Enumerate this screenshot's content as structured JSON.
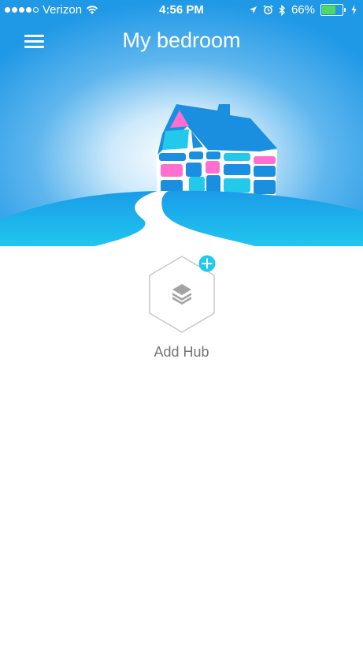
{
  "status_bar": {
    "carrier": "Verizon",
    "signal_bars_filled": 4,
    "signal_bars_total": 5,
    "time": "4:56 PM",
    "battery_percent_label": "66%",
    "battery_level": 0.66,
    "icons": [
      "wifi-icon",
      "location-arrow-icon",
      "alarm-icon",
      "bluetooth-icon",
      "battery-icon",
      "charging-bolt-icon"
    ]
  },
  "header": {
    "title": "My bedroom",
    "menu_icon": "hamburger-menu-icon"
  },
  "main": {
    "add_hub_label": "Add Hub",
    "add_hub_icon": "layers-icon",
    "add_badge_icon": "plus-icon"
  },
  "colors": {
    "sky_top": "#1f98e6",
    "hill": "#1aa6ec",
    "accent_cyan": "#23c9ea",
    "pink": "#ff6fd0",
    "label_gray": "#757575",
    "hex_outline": "#c8c8c8"
  }
}
